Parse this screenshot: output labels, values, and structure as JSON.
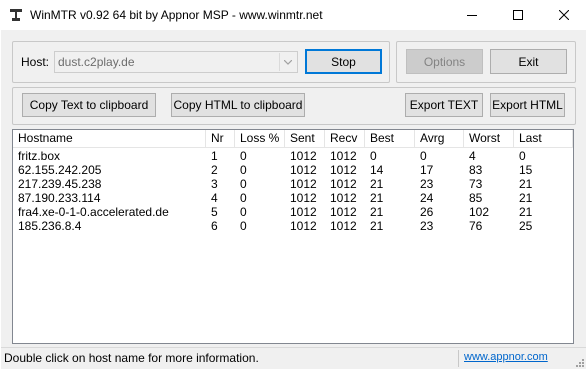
{
  "window": {
    "title": "WinMTR v0.92 64 bit by Appnor MSP - www.winmtr.net",
    "app_icon": "hammer-anvil-icon"
  },
  "controls": {
    "host_label": "Host:",
    "host_value": "dust.c2play.de",
    "stop_label": "Stop",
    "options_label": "Options",
    "exit_label": "Exit",
    "copy_text_label": "Copy Text to clipboard",
    "copy_html_label": "Copy HTML to clipboard",
    "export_text_label": "Export TEXT",
    "export_html_label": "Export HTML"
  },
  "table": {
    "columns": [
      "Hostname",
      "Nr",
      "Loss %",
      "Sent",
      "Recv",
      "Best",
      "Avrg",
      "Worst",
      "Last"
    ],
    "rows": [
      [
        "fritz.box",
        "1",
        "0",
        "1012",
        "1012",
        "0",
        "0",
        "4",
        "0"
      ],
      [
        "62.155.242.205",
        "2",
        "0",
        "1012",
        "1012",
        "14",
        "17",
        "83",
        "15"
      ],
      [
        "217.239.45.238",
        "3",
        "0",
        "1012",
        "1012",
        "21",
        "23",
        "73",
        "21"
      ],
      [
        "87.190.233.114",
        "4",
        "0",
        "1012",
        "1012",
        "21",
        "24",
        "85",
        "21"
      ],
      [
        "fra4.xe-0-1-0.accelerated.de",
        "5",
        "0",
        "1012",
        "1012",
        "21",
        "26",
        "102",
        "21"
      ],
      [
        "185.236.8.4",
        "6",
        "0",
        "1012",
        "1012",
        "21",
        "23",
        "76",
        "25"
      ]
    ]
  },
  "status": {
    "message": "Double click on host name for more information.",
    "link": "www.appnor.com"
  }
}
